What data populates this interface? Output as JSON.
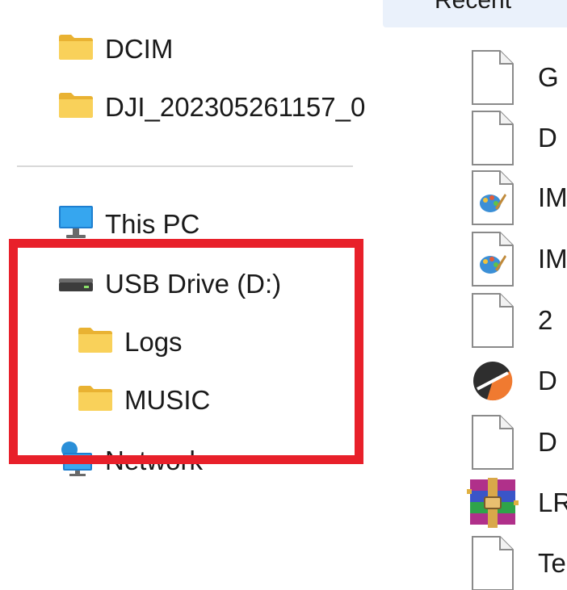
{
  "nav": {
    "items": [
      {
        "label": "DCIM",
        "icon": "folder-icon"
      },
      {
        "label": "DJI_202305261157_0",
        "icon": "folder-icon"
      },
      {
        "label": "This PC",
        "icon": "monitor-icon"
      },
      {
        "label": "USB Drive (D:)",
        "icon": "drive-icon"
      },
      {
        "label": "Logs",
        "icon": "folder-icon"
      },
      {
        "label": "MUSIC",
        "icon": "folder-icon"
      },
      {
        "label": "Network",
        "icon": "network-icon"
      }
    ]
  },
  "content": {
    "section_header": "Recent",
    "files": [
      {
        "name": "G",
        "icon": "blank-file-icon"
      },
      {
        "name": "D",
        "icon": "blank-file-icon"
      },
      {
        "name": "IM",
        "icon": "image-file-icon"
      },
      {
        "name": "IM",
        "icon": "image-file-icon"
      },
      {
        "name": "2",
        "icon": "blank-file-icon"
      },
      {
        "name": "D",
        "icon": "app-file-icon"
      },
      {
        "name": "D",
        "icon": "blank-file-icon"
      },
      {
        "name": "LR",
        "icon": "archive-file-icon"
      },
      {
        "name": "Te",
        "icon": "blank-file-icon"
      }
    ]
  },
  "colors": {
    "highlight": "#e8202a",
    "folder": "#f7c948",
    "header_bg": "#eaf1fb"
  }
}
